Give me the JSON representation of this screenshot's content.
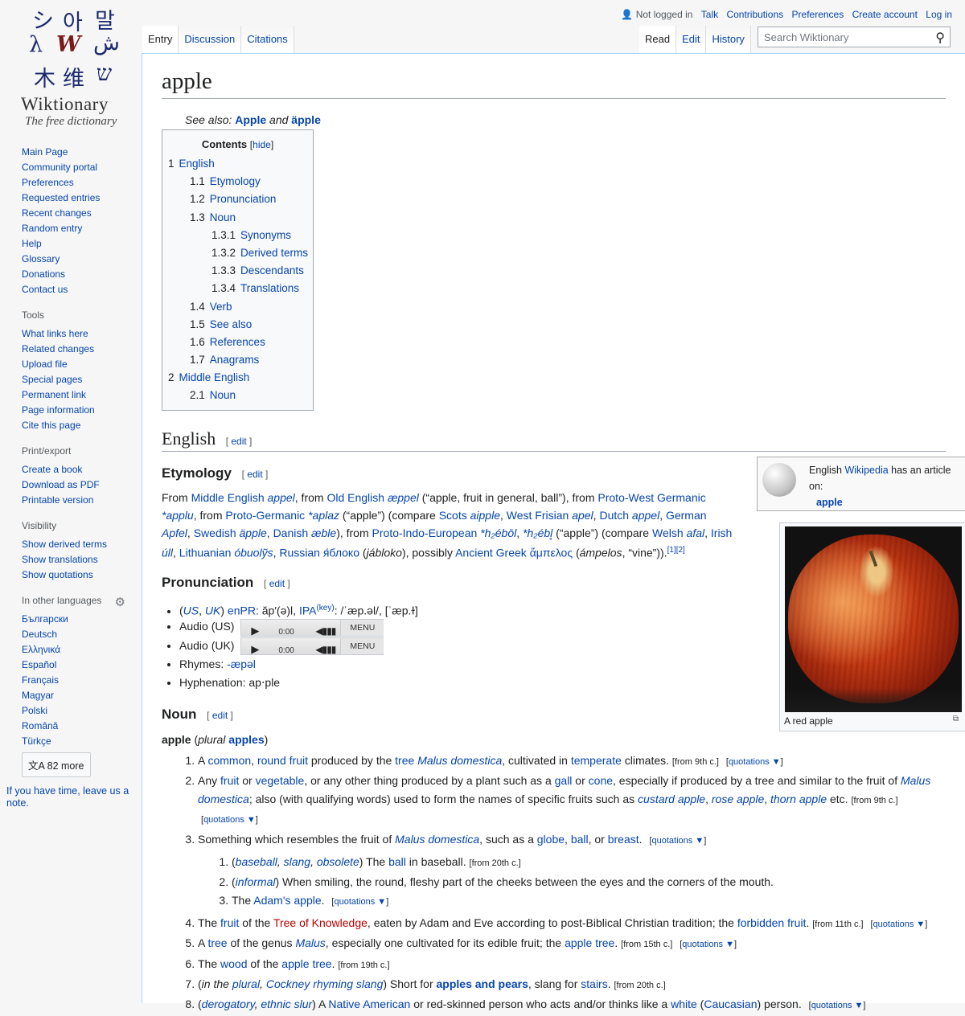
{
  "logo": {
    "glyphs": [
      "シ",
      "아",
      "말",
      "λ",
      "W",
      "ش",
      "木",
      "维",
      "ש"
    ],
    "wordmark": "Wiktionary",
    "tagline": "The free dictionary"
  },
  "sidebar": {
    "navigation": [
      "Main Page",
      "Community portal",
      "Preferences",
      "Requested entries",
      "Recent changes",
      "Random entry",
      "Help",
      "Glossary",
      "Donations",
      "Contact us"
    ],
    "tools_heading": "Tools",
    "tools": [
      "What links here",
      "Related changes",
      "Upload file",
      "Special pages",
      "Permanent link",
      "Page information",
      "Cite this page"
    ],
    "print_heading": "Print/export",
    "print": [
      "Create a book",
      "Download as PDF",
      "Printable version"
    ],
    "visibility_heading": "Visibility",
    "visibility": [
      "Show derived terms",
      "Show translations",
      "Show quotations"
    ],
    "languages_heading": "In other languages",
    "languages": [
      "Български",
      "Deutsch",
      "Ελληνικά",
      "Español",
      "Français",
      "Magyar",
      "Polski",
      "Română",
      "Türkçe"
    ],
    "more_languages": "82 more",
    "note": "If you have time, leave us a note."
  },
  "personal": {
    "user": "Not logged in",
    "links": [
      "Talk",
      "Contributions",
      "Preferences",
      "Create account",
      "Log in"
    ]
  },
  "tabs": {
    "left": [
      "Entry",
      "Discussion",
      "Citations"
    ],
    "right": [
      "Read",
      "Edit",
      "History"
    ]
  },
  "search": {
    "placeholder": "Search Wiktionary"
  },
  "page": {
    "title": "apple",
    "see_also_label": "See also:",
    "see_also_1": "Apple",
    "see_also_and": "and",
    "see_also_2": "äpple"
  },
  "toc": {
    "title": "Contents",
    "hide": "hide",
    "items": [
      {
        "num": "1",
        "label": "English",
        "level": 1
      },
      {
        "num": "1.1",
        "label": "Etymology",
        "level": 2
      },
      {
        "num": "1.2",
        "label": "Pronunciation",
        "level": 2
      },
      {
        "num": "1.3",
        "label": "Noun",
        "level": 2
      },
      {
        "num": "1.3.1",
        "label": "Synonyms",
        "level": 3
      },
      {
        "num": "1.3.2",
        "label": "Derived terms",
        "level": 3
      },
      {
        "num": "1.3.3",
        "label": "Descendants",
        "level": 3
      },
      {
        "num": "1.3.4",
        "label": "Translations",
        "level": 3
      },
      {
        "num": "1.4",
        "label": "Verb",
        "level": 2
      },
      {
        "num": "1.5",
        "label": "See also",
        "level": 2
      },
      {
        "num": "1.6",
        "label": "References",
        "level": 2
      },
      {
        "num": "1.7",
        "label": "Anagrams",
        "level": 2
      },
      {
        "num": "2",
        "label": "Middle English",
        "level": 1
      },
      {
        "num": "2.1",
        "label": "Noun",
        "level": 2
      }
    ]
  },
  "sections": {
    "english": "English",
    "etymology": "Etymology",
    "pronunciation": "Pronunciation",
    "noun": "Noun",
    "edit": "edit"
  },
  "wikipedia_box": {
    "prefix": "English",
    "link": "Wikipedia",
    "suffix": "has an article on:",
    "article": "apple"
  },
  "thumb": {
    "caption": "A red apple"
  },
  "pronunciation": {
    "us": "US",
    "uk": "UK",
    "enpr": "enPR",
    "enpr_value": ": ăp′(ə)l, ",
    "ipa": "IPA",
    "key": "(key)",
    "ipa_value": ": /ˈæp.əl/, [ˈæp.ɫ]",
    "audio_us": "Audio (US)",
    "audio_uk": "Audio (UK)",
    "time": "0:00",
    "menu": "MENU",
    "rhymes_label": "Rhymes:",
    "rhymes": "-æpəl",
    "hyphenation": "Hyphenation: ap‧ple"
  },
  "headword": {
    "word": "apple",
    "plural_label": "plural",
    "plural": "apples"
  },
  "quotations": "quotations ▼"
}
